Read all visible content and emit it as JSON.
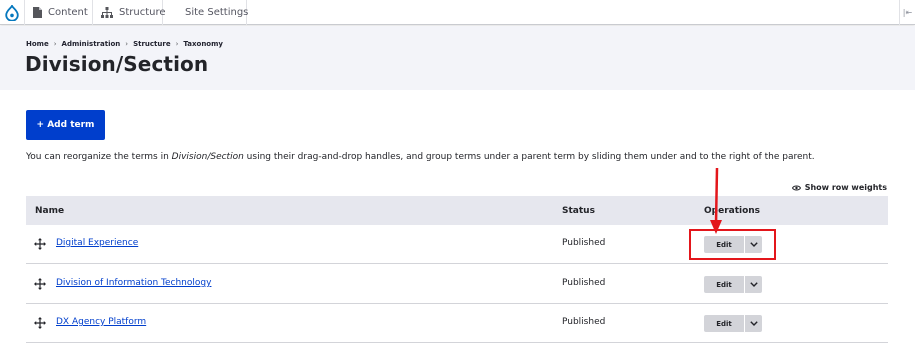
{
  "toolbar": {
    "items": [
      {
        "label": "Content",
        "icon": "file-icon"
      },
      {
        "label": "Structure",
        "icon": "sitemap-icon"
      },
      {
        "label": "Site Settings"
      }
    ]
  },
  "breadcrumb": [
    "Home",
    "Administration",
    "Structure",
    "Taxonomy"
  ],
  "breadcrumb_separator": "›",
  "page_title": "Division/Section",
  "add_button": "+ Add term",
  "help": {
    "before": "You can reorganize the terms in ",
    "vocabulary": "Division/Section",
    "after": " using their drag-and-drop handles, and group terms under a parent term by sliding them under and to the right of the parent."
  },
  "row_weights_label": "Show row weights",
  "table": {
    "headers": {
      "name": "Name",
      "status": "Status",
      "operations": "Operations"
    },
    "rows": [
      {
        "name": "Digital Experience",
        "status": "Published",
        "edit": "Edit"
      },
      {
        "name": "Division of Information Technology",
        "status": "Published",
        "edit": "Edit"
      },
      {
        "name": "DX Agency Platform",
        "status": "Published",
        "edit": "Edit"
      }
    ]
  },
  "colors": {
    "accent": "#003ecc",
    "annotation": "#e3161b",
    "header_bg": "#f3f4f9",
    "table_head_bg": "#e6e7ee"
  }
}
